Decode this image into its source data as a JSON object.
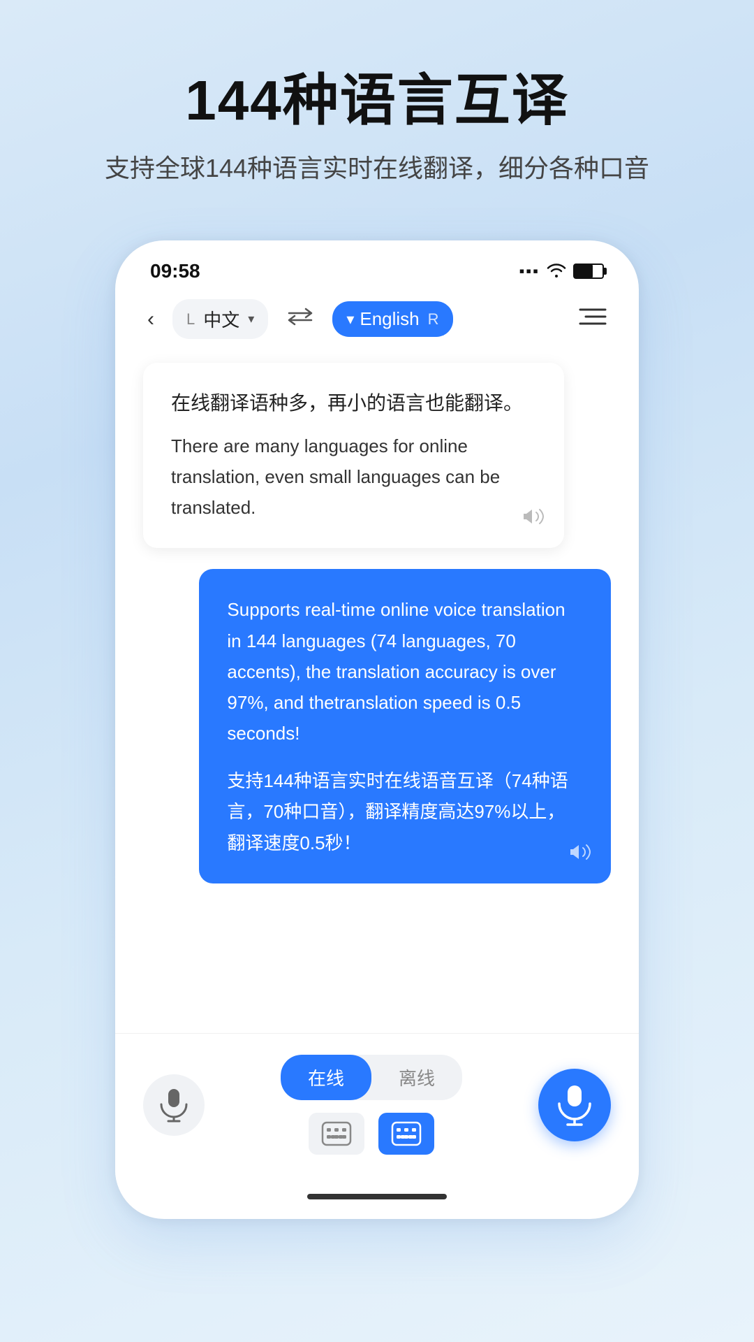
{
  "page": {
    "background_gradient": "linear-gradient(160deg, #daeaf8, #c8dff5, #d8eaf8, #e8f3fb)"
  },
  "header": {
    "main_title": "144种语言互译",
    "sub_title": "支持全球144种语言实时在线翻译，细分各种口音"
  },
  "phone": {
    "status_bar": {
      "time": "09:58",
      "signal": "▪▪▪",
      "wifi": "WiFi",
      "battery": "65%"
    },
    "nav_bar": {
      "back_icon": "‹",
      "lang_left_label": "L",
      "lang_left": "中文",
      "dropdown_icon": "▾",
      "swap_icon": "⇄",
      "lang_right_flag": "▾",
      "lang_right": "English",
      "lang_right_label": "R",
      "menu_icon": "☰"
    },
    "chat": {
      "bubble_left": {
        "text_cn": "在线翻译语种多，再小的语言也能翻译。",
        "text_en": "There are many languages for online translation, even small languages can be translated.",
        "sound_icon": "◀))"
      },
      "bubble_right": {
        "text_en": "Supports real-time online voice translation in 144 languages (74 languages, 70 accents), the translation accuracy is over 97%, and thetranslation speed is 0.5 seconds!",
        "text_cn": "支持144种语言实时在线语音互译（74种语言，70种口音），翻译精度高达97%以上，翻译速度0.5秒！",
        "sound_icon": "◀))"
      }
    },
    "toolbar": {
      "mic_left_icon": "🎤",
      "mode_online": "在线",
      "mode_offline": "离线",
      "keyboard_left_icon": "⌨",
      "keyboard_right_icon": "⌨",
      "mic_right_icon": "🎤"
    }
  }
}
